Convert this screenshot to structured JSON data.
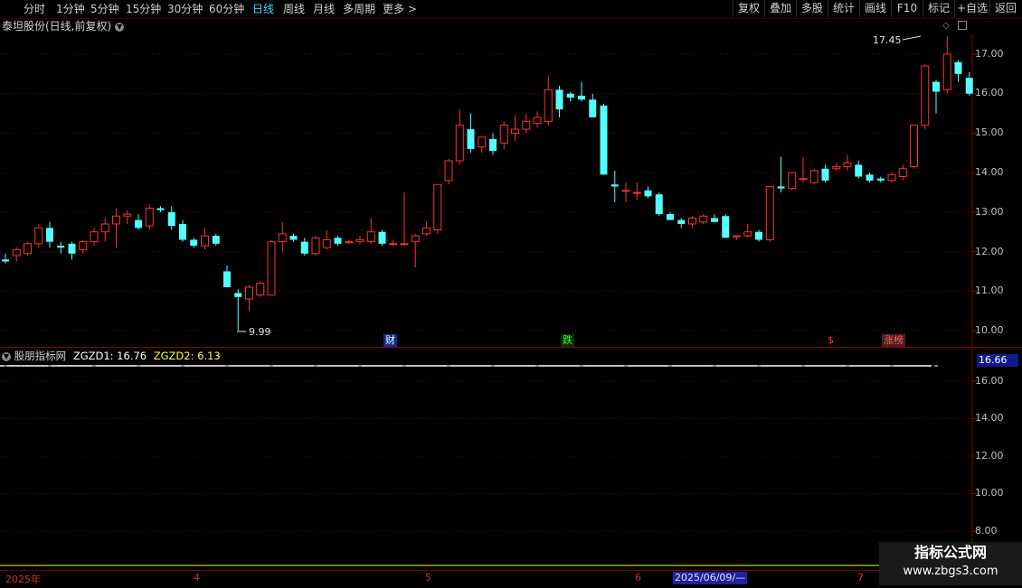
{
  "periods": [
    "分时",
    "1分钟",
    "5分钟",
    "15分钟",
    "30分钟",
    "60分钟",
    "日线",
    "周线",
    "月线",
    "多周期",
    "更多 >"
  ],
  "active_period": "日线",
  "right_buttons": [
    "复权",
    "叠加",
    "多股",
    "统计",
    "画线",
    "F10",
    "标记",
    "+自选",
    "返回"
  ],
  "stock_info": "泰坦股份(日线,前复权)",
  "price_axis": [
    "17.00",
    "16.00",
    "15.00",
    "14.00",
    "13.00",
    "12.00",
    "11.00",
    "10.00"
  ],
  "high_label": "17.45",
  "low_label": "9.99",
  "signals": [
    {
      "text": "财",
      "color": "#ffffff",
      "bg": "#0f2e8c"
    },
    {
      "text": "跌",
      "color": "#3cff3c",
      "bg": "#0a2d0a"
    },
    {
      "text": "$",
      "color": "#ff3b3b",
      "bg": "#000000"
    },
    {
      "text": "涨榜",
      "color": "#ff5e5e",
      "bg": "#4a1c1c"
    }
  ],
  "indicator": {
    "name": "股朋指标网",
    "zgzd1_label": "ZGZD1: 16.76",
    "zgzd2_label": "ZGZD2: 6.13",
    "zgzd1_color": "#ffffff",
    "zgzd2_color": "#ffff00"
  },
  "sub_axis": [
    "16.00",
    "14.00",
    "12.00",
    "10.00",
    "8.00"
  ],
  "cursor_value": "16.66",
  "dates": {
    "year": "2025年",
    "m4": "4",
    "m5": "5",
    "m6": "6",
    "m7": "7",
    "selected": "2025/06/09/—"
  },
  "brand": {
    "line1": "指标公式网",
    "line2": "www.zbgs3.com"
  },
  "colors": {
    "up": "#ff3232",
    "down": "#54ffff",
    "grid": "#6e0000",
    "axis": "#8b0000"
  },
  "chart_data": {
    "type": "candlestick",
    "ylim": [
      9.8,
      17.5
    ],
    "candles": [
      [
        11.8,
        11.95,
        11.7,
        11.75
      ],
      [
        11.9,
        12.1,
        11.75,
        12.05
      ],
      [
        11.95,
        12.25,
        11.9,
        12.2
      ],
      [
        12.2,
        12.7,
        12.1,
        12.6
      ],
      [
        12.6,
        12.75,
        12.1,
        12.25
      ],
      [
        12.15,
        12.25,
        11.95,
        12.1
      ],
      [
        12.2,
        12.25,
        11.8,
        11.95
      ],
      [
        12.05,
        12.3,
        11.95,
        12.25
      ],
      [
        12.25,
        12.6,
        12.15,
        12.5
      ],
      [
        12.5,
        12.85,
        12.25,
        12.7
      ],
      [
        12.7,
        13.1,
        12.1,
        12.9
      ],
      [
        12.9,
        13.05,
        12.7,
        12.95
      ],
      [
        12.8,
        12.95,
        12.55,
        12.6
      ],
      [
        12.65,
        13.2,
        12.55,
        13.1
      ],
      [
        13.1,
        13.15,
        13.0,
        13.05
      ],
      [
        13.0,
        13.15,
        12.55,
        12.65
      ],
      [
        12.7,
        12.8,
        12.25,
        12.3
      ],
      [
        12.3,
        12.35,
        12.1,
        12.15
      ],
      [
        12.15,
        12.6,
        12.05,
        12.4
      ],
      [
        12.4,
        12.45,
        12.15,
        12.2
      ],
      [
        11.5,
        11.65,
        11.1,
        11.1
      ],
      [
        10.95,
        11.05,
        10.0,
        10.85
      ],
      [
        10.8,
        11.15,
        10.5,
        11.1
      ],
      [
        10.9,
        11.25,
        10.85,
        11.2
      ],
      [
        10.9,
        12.3,
        10.9,
        12.25
      ],
      [
        12.25,
        12.75,
        12.0,
        12.45
      ],
      [
        12.4,
        12.45,
        12.25,
        12.3
      ],
      [
        12.25,
        12.35,
        11.9,
        11.95
      ],
      [
        11.95,
        12.4,
        11.9,
        12.35
      ],
      [
        12.1,
        12.55,
        12.05,
        12.3
      ],
      [
        12.35,
        12.4,
        12.15,
        12.2
      ],
      [
        12.25,
        12.3,
        12.2,
        12.25
      ],
      [
        12.25,
        12.4,
        12.2,
        12.3
      ],
      [
        12.25,
        12.85,
        12.2,
        12.5
      ],
      [
        12.5,
        12.55,
        12.15,
        12.2
      ],
      [
        12.2,
        12.3,
        12.15,
        12.2
      ],
      [
        12.2,
        13.5,
        12.15,
        12.2
      ],
      [
        12.25,
        12.45,
        11.6,
        12.4
      ],
      [
        12.45,
        12.75,
        12.4,
        12.6
      ],
      [
        12.55,
        13.0,
        12.45,
        13.7
      ],
      [
        13.8,
        14.35,
        13.7,
        14.3
      ],
      [
        14.3,
        15.6,
        14.2,
        15.2
      ],
      [
        15.1,
        15.5,
        14.5,
        14.6
      ],
      [
        14.65,
        14.9,
        14.5,
        14.9
      ],
      [
        14.85,
        15.0,
        14.45,
        14.55
      ],
      [
        14.75,
        15.3,
        14.6,
        15.2
      ],
      [
        15.0,
        15.45,
        14.8,
        15.1
      ],
      [
        15.1,
        15.5,
        15.0,
        15.3
      ],
      [
        15.25,
        15.55,
        15.15,
        15.4
      ],
      [
        15.3,
        16.45,
        15.2,
        16.1
      ],
      [
        16.1,
        16.2,
        15.4,
        15.6
      ],
      [
        16.0,
        16.05,
        15.8,
        15.9
      ],
      [
        15.95,
        16.3,
        15.8,
        15.85
      ],
      [
        15.85,
        16.0,
        15.5,
        15.4
      ],
      [
        15.7,
        15.75,
        13.95,
        13.95
      ],
      [
        13.7,
        14.05,
        13.25,
        13.65
      ],
      [
        13.55,
        13.75,
        13.25,
        13.55
      ],
      [
        13.5,
        13.75,
        13.3,
        13.5
      ],
      [
        13.55,
        13.65,
        13.35,
        13.4
      ],
      [
        13.45,
        13.5,
        12.9,
        12.95
      ],
      [
        12.95,
        13.0,
        12.8,
        12.8
      ],
      [
        12.8,
        12.85,
        12.6,
        12.7
      ],
      [
        12.7,
        12.9,
        12.6,
        12.85
      ],
      [
        12.75,
        12.95,
        12.7,
        12.9
      ],
      [
        12.85,
        12.95,
        12.8,
        12.75
      ],
      [
        12.9,
        12.95,
        12.35,
        12.35
      ],
      [
        12.4,
        12.4,
        12.3,
        12.4
      ],
      [
        12.4,
        12.7,
        12.35,
        12.5
      ],
      [
        12.5,
        12.55,
        12.25,
        12.3
      ],
      [
        12.3,
        13.65,
        12.25,
        13.65
      ],
      [
        13.65,
        14.4,
        13.5,
        13.6
      ],
      [
        13.6,
        14.0,
        13.55,
        14.0
      ],
      [
        13.85,
        14.4,
        13.75,
        13.85
      ],
      [
        13.75,
        14.1,
        13.7,
        14.05
      ],
      [
        14.1,
        14.2,
        13.75,
        13.8
      ],
      [
        14.1,
        14.25,
        14.05,
        14.15
      ],
      [
        14.15,
        14.45,
        14.05,
        14.25
      ],
      [
        14.2,
        14.3,
        13.85,
        13.9
      ],
      [
        13.95,
        14.0,
        13.75,
        13.8
      ],
      [
        13.85,
        13.9,
        13.75,
        13.8
      ],
      [
        13.8,
        14.0,
        13.75,
        13.95
      ],
      [
        13.9,
        14.2,
        13.8,
        14.1
      ],
      [
        14.15,
        15.2,
        14.1,
        15.2
      ],
      [
        15.2,
        16.75,
        15.1,
        16.7
      ],
      [
        16.3,
        16.35,
        15.5,
        16.05
      ],
      [
        16.1,
        17.45,
        16.0,
        17.0
      ],
      [
        16.8,
        16.85,
        16.3,
        16.5
      ],
      [
        16.4,
        16.55,
        15.95,
        16.0
      ]
    ],
    "zgzd1": 16.76,
    "zgzd2": 6.13,
    "sub_ylim": [
      7.2,
      17.2
    ]
  }
}
